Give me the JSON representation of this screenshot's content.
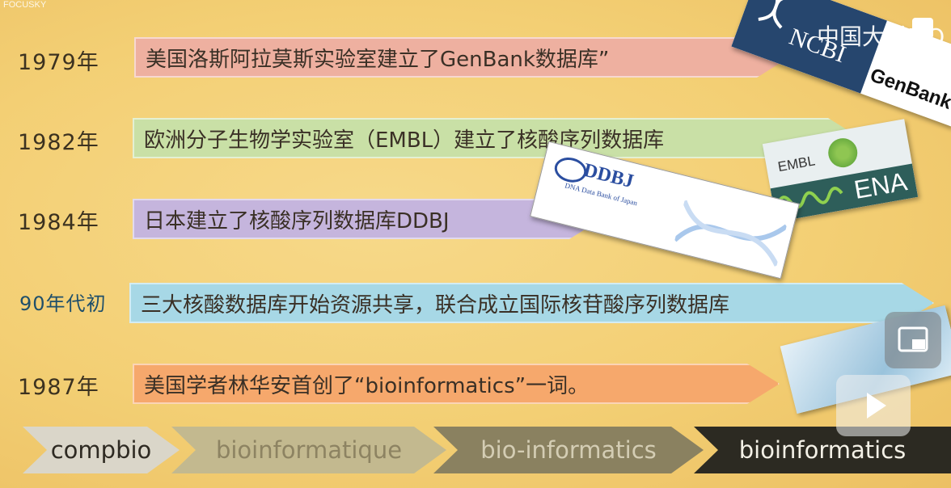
{
  "watermark": "FOCUSKY",
  "timeline": [
    {
      "year": "1979年",
      "text": "美国洛斯阿拉莫斯实验室建立了GenBank数据库”",
      "color": "#eeb0a0"
    },
    {
      "year": "1982年",
      "text": "欧洲分子生物学实验室（EMBL）建立了核酸序列数据库",
      "color": "#c9e0a6"
    },
    {
      "year": "1984年",
      "text": "日本建立了核酸序列数据库DDBJ",
      "color": "#c5b5dd"
    },
    {
      "year": "90年代初",
      "text": "三大核酸数据库开始资源共享，联合成立国际核苷酸序列数据库",
      "color": "#a7d8e6"
    },
    {
      "year": "1987年",
      "text": "美国学者林华安首创了“bioinformatics”一词。",
      "color": "#f6a86c"
    }
  ],
  "terms": [
    {
      "label": "compbio",
      "bg": "#dad6c9",
      "fg": "#2e2a22"
    },
    {
      "label": "bioinformatique",
      "bg": "#c3b98f",
      "fg": "#8d8362"
    },
    {
      "label": "bio-informatics",
      "bg": "#8a8160",
      "fg": "#d4cdb4"
    },
    {
      "label": "bioinformatics",
      "bg": "#2c2a22",
      "fg": "#f3f0e6"
    }
  ],
  "logos": {
    "ncbi": "NCBI",
    "genbank": "GenBank",
    "embl": "EMBL",
    "ena": "ENA",
    "ddbj": "DDBJ",
    "ddbj_sub": "DNA Data Bank of Japan"
  },
  "overlay": {
    "mooc_text": "中国大学MO"
  }
}
